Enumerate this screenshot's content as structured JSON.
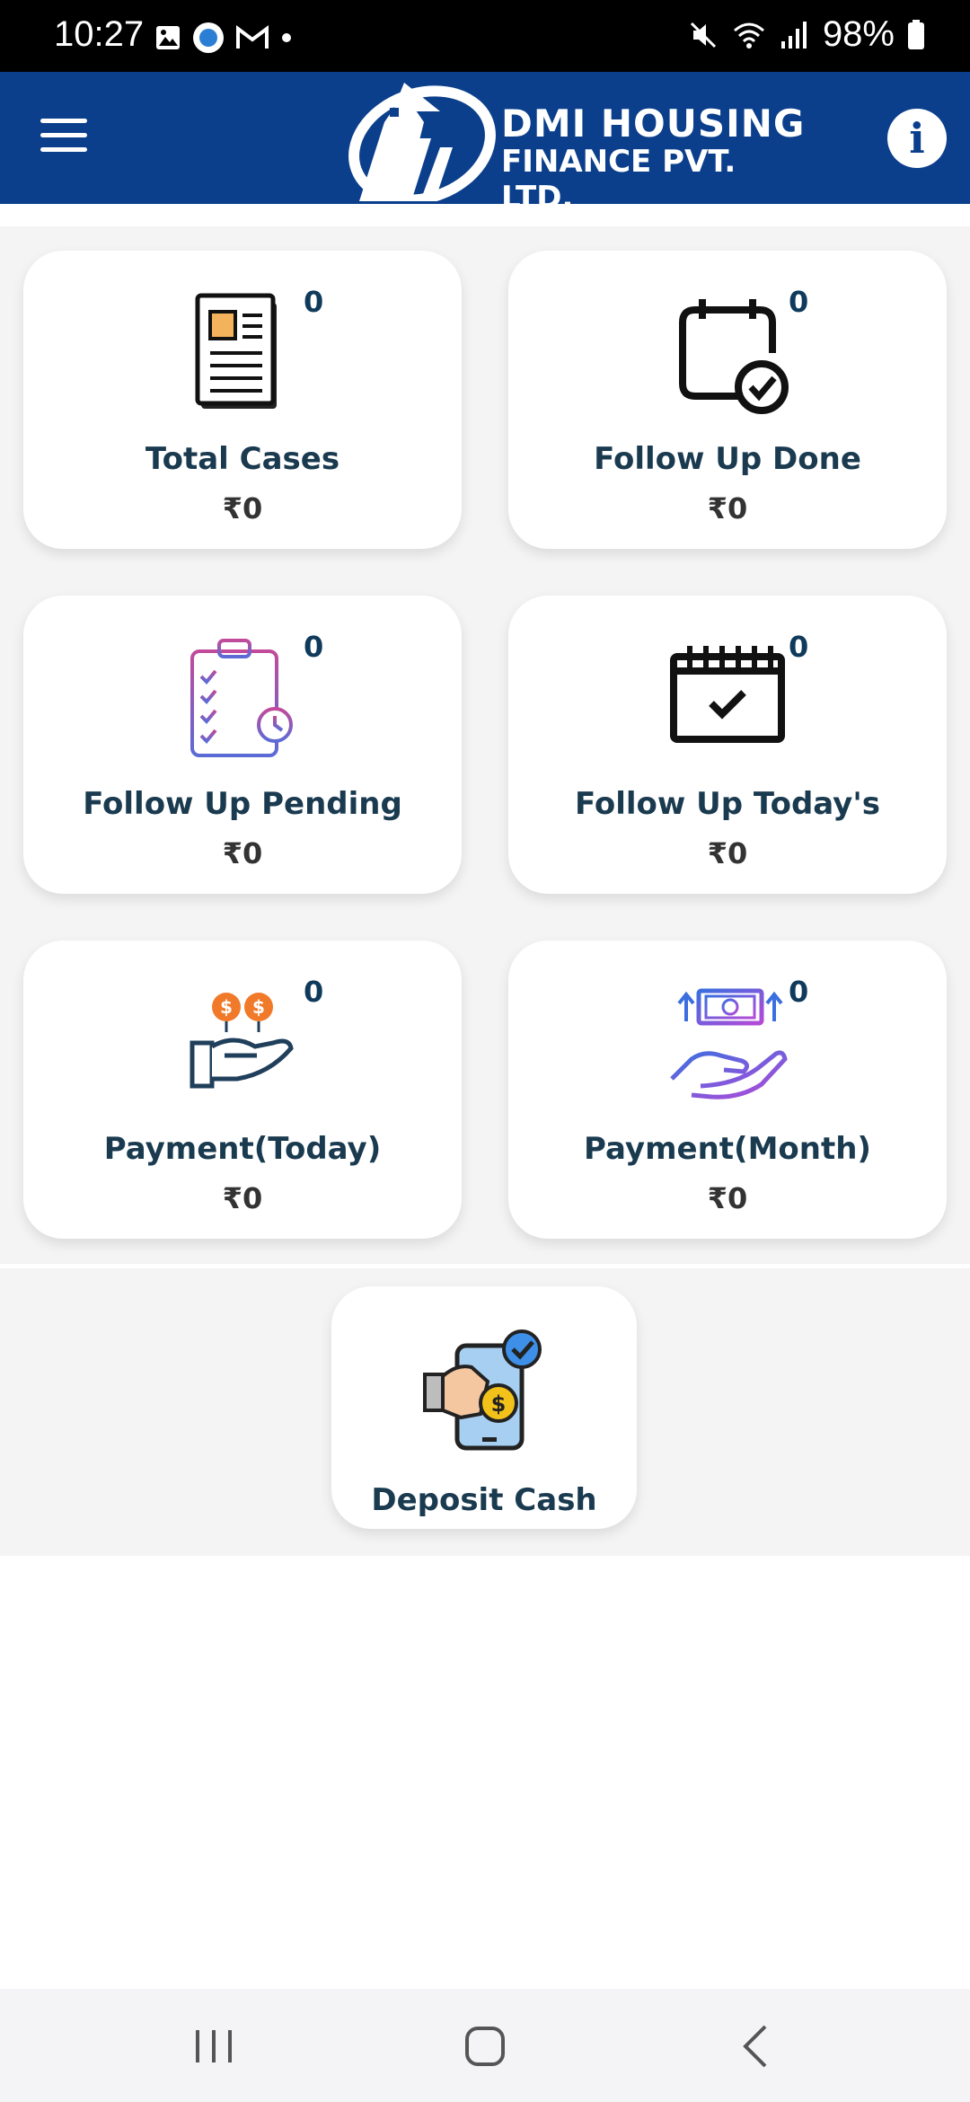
{
  "status_bar": {
    "time": "10:27",
    "battery": "98%",
    "left_icons": [
      "gallery-icon",
      "app-icon",
      "gmail-icon",
      "dot-icon"
    ],
    "right_icons": [
      "mute-icon",
      "wifi-icon",
      "signal-icon",
      "battery-icon"
    ]
  },
  "header": {
    "brand_line1": "DMI HOUSING",
    "brand_line2": "FINANCE PVT. LTD.",
    "background": "#0b3f8c",
    "menu_icon": "hamburger-icon",
    "info_icon": "info-icon",
    "info_glyph": "i"
  },
  "cards": [
    {
      "label": "Total Cases",
      "count": "0",
      "amount": "₹0",
      "icon": "document-icon"
    },
    {
      "label": "Follow Up Done",
      "count": "0",
      "amount": "₹0",
      "icon": "calendar-check-icon"
    },
    {
      "label": "Follow Up Pending",
      "count": "0",
      "amount": "₹0",
      "icon": "clipboard-clock-icon"
    },
    {
      "label": "Follow Up Today's",
      "count": "0",
      "amount": "₹0",
      "icon": "calendar-tick-icon"
    },
    {
      "label": "Payment(Today)",
      "count": "0",
      "amount": "₹0",
      "icon": "hand-coins-icon"
    },
    {
      "label": "Payment(Month)",
      "count": "0",
      "amount": "₹0",
      "icon": "hand-cash-icon"
    }
  ],
  "deposit": {
    "label": "Deposit Cash",
    "icon": "phone-payment-icon"
  },
  "nav_bar": {
    "buttons": [
      "recents-icon",
      "home-icon",
      "back-icon"
    ]
  }
}
